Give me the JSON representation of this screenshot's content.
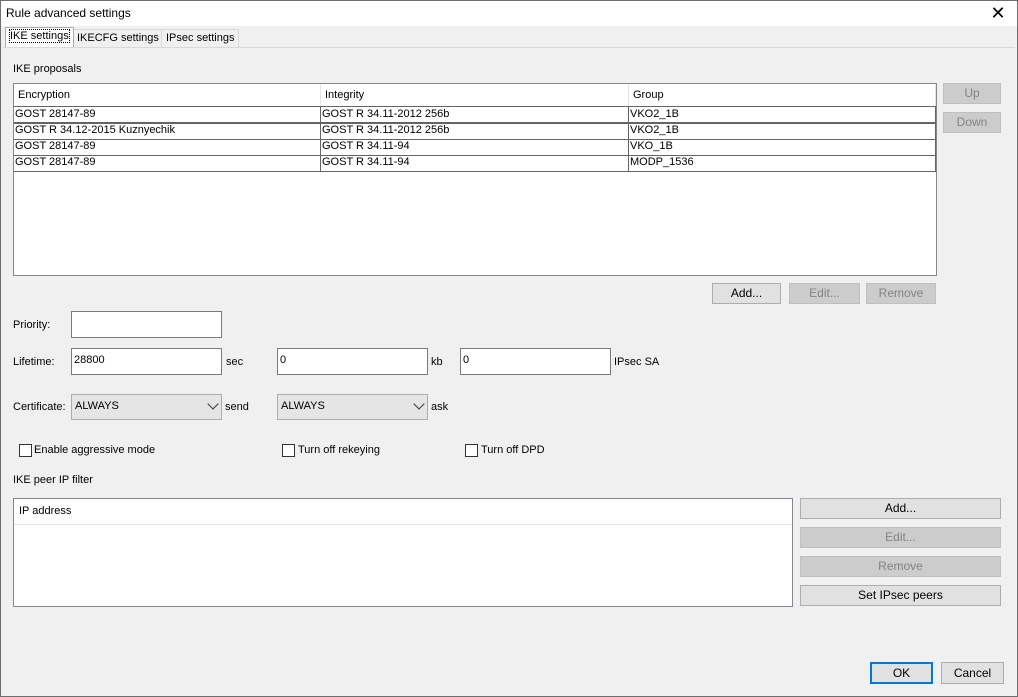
{
  "window": {
    "title": "Rule advanced settings",
    "close_glyph": "✕"
  },
  "tabs": [
    {
      "label": "IKE settings"
    },
    {
      "label": "IKECFG settings"
    },
    {
      "label": "IPsec settings"
    }
  ],
  "ike_proposals": {
    "section_label": "IKE proposals",
    "columns": [
      "Encryption",
      "Integrity",
      "Group"
    ],
    "rows": [
      [
        "GOST 28147-89",
        "GOST R 34.11-2012 256b",
        "VKO2_1B"
      ],
      [
        "GOST R 34.12-2015 Kuznyechik",
        "GOST R 34.11-2012 256b",
        "VKO2_1B"
      ],
      [
        "GOST 28147-89",
        "GOST R 34.11-94",
        "VKO_1B"
      ],
      [
        "GOST 28147-89",
        "GOST R 34.11-94",
        "MODP_1536"
      ]
    ],
    "buttons": {
      "up": "Up",
      "down": "Down",
      "add": "Add...",
      "edit": "Edit...",
      "remove": "Remove"
    }
  },
  "priority": {
    "label": "Priority:",
    "value": ""
  },
  "lifetime": {
    "label": "Lifetime:",
    "sec_value": "28800",
    "sec_unit": "sec",
    "kb_value": "0",
    "kb_unit": "kb",
    "sa_value": "0",
    "sa_unit": "IPsec SA"
  },
  "certificate": {
    "label": "Certificate:",
    "send_value": "ALWAYS",
    "send_label": "send",
    "ask_value": "ALWAYS",
    "ask_label": "ask"
  },
  "checkboxes": {
    "aggressive": "Enable aggressive mode",
    "rekeying": "Turn off rekeying",
    "dpd": "Turn off DPD"
  },
  "peer_filter": {
    "section_label": "IKE peer IP filter",
    "column": "IP address",
    "buttons": {
      "add": "Add...",
      "edit": "Edit...",
      "remove": "Remove",
      "set_peers": "Set IPsec peers"
    }
  },
  "footer": {
    "ok": "OK",
    "cancel": "Cancel"
  }
}
